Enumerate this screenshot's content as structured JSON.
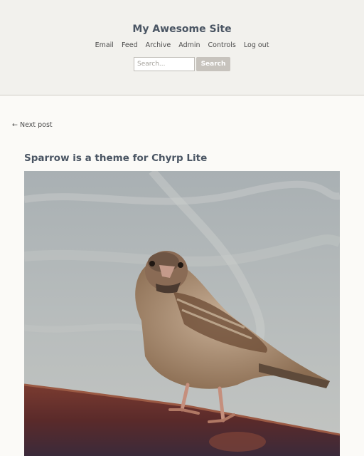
{
  "site": {
    "title": "My Awesome Site"
  },
  "nav": [
    {
      "label": "Email"
    },
    {
      "label": "Feed"
    },
    {
      "label": "Archive"
    },
    {
      "label": "Admin"
    },
    {
      "label": "Controls"
    },
    {
      "label": "Log out"
    }
  ],
  "search": {
    "placeholder": "Search...",
    "button_label": "Search"
  },
  "post_nav": {
    "next_label": "← Next post"
  },
  "post": {
    "title": "Sparrow is a theme for Chyrp Lite"
  }
}
